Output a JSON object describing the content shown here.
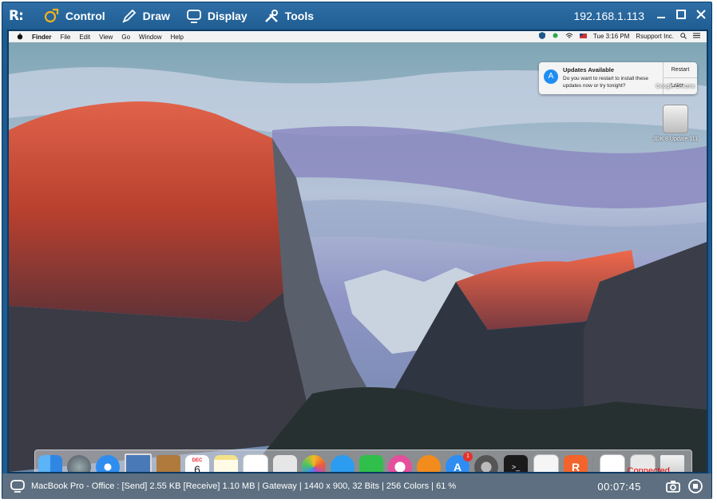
{
  "toolbar": {
    "logo": "R:",
    "control_label": "Control",
    "draw_label": "Draw",
    "display_label": "Display",
    "tools_label": "Tools",
    "ip": "192.168.1.113"
  },
  "mac": {
    "menu": [
      "Finder",
      "File",
      "Edit",
      "View",
      "Go",
      "Window",
      "Help"
    ],
    "clock": "Tue 3:16 PM",
    "user": "Rsupport Inc.",
    "notification": {
      "title": "Updates Available",
      "message": "Do you want to restart to install these updates now or try tonight?",
      "restart": "Restart",
      "later": "Later"
    },
    "desktop_icons": [
      "Google Chrome",
      "JDK 8 Update 111"
    ],
    "dock_badge": "1",
    "calendar_month": "DEC",
    "calendar_day": "6"
  },
  "overlay": {
    "connected": "Connected..."
  },
  "status": {
    "info": "MacBook Pro - Office : [Send] 2.55 KB  [Receive] 1.10 MB | Gateway | 1440 x 900, 32 Bits | 256 Colors | 61 %",
    "timer": "00:07:45"
  }
}
